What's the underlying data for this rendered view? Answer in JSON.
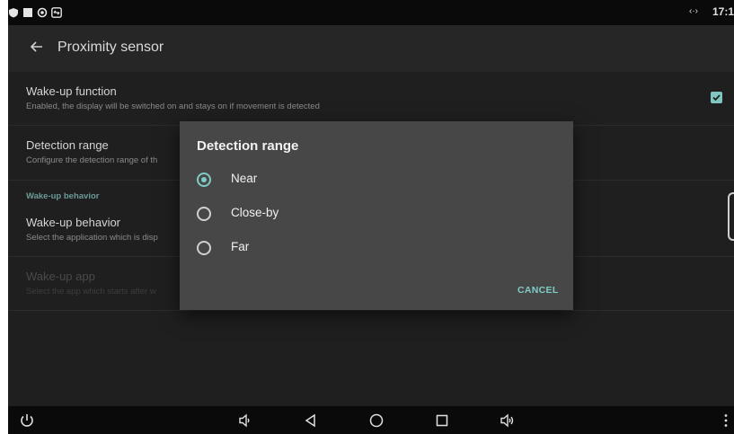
{
  "status_bar": {
    "time": "17:1",
    "sync_glyph": "‹·›"
  },
  "app_bar": {
    "title": "Proximity sensor",
    "back_icon": "arrow-left-icon"
  },
  "prefs": {
    "wakeup_function": {
      "title": "Wake-up function",
      "summary": "Enabled, the display will be switched on and stays on if movement is detected",
      "checked": true
    },
    "detection_range": {
      "title": "Detection range",
      "summary": "Configure the detection range of th"
    },
    "section_header": "Wake-up behavior",
    "wakeup_behavior": {
      "title": "Wake-up behavior",
      "summary": "Select the application which is disp"
    },
    "wakeup_app": {
      "title": "Wake-up app",
      "summary": "Select the app which starts after w"
    }
  },
  "dialog": {
    "title": "Detection range",
    "options": [
      {
        "label": "Near",
        "selected": true
      },
      {
        "label": "Close-by",
        "selected": false
      },
      {
        "label": "Far",
        "selected": false
      }
    ],
    "cancel_label": "CANCEL"
  },
  "colors": {
    "accent": "#80cbc4",
    "background": "#1f1f1f",
    "dialog": "#474747"
  },
  "nav_icons": [
    "power-icon",
    "volume-down-icon",
    "back-icon",
    "home-icon",
    "recents-icon",
    "volume-up-icon",
    "more-icon"
  ]
}
